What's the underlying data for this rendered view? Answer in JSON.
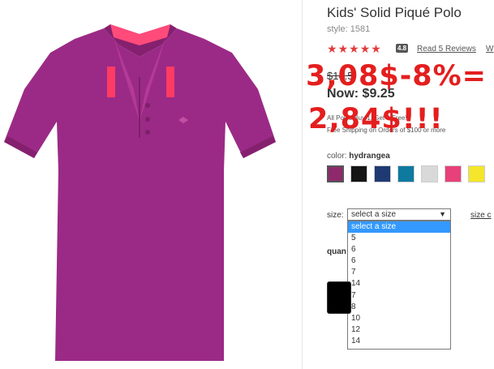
{
  "product": {
    "title": "Kids' Solid Piqué Polo",
    "style": "style: 1581",
    "rating": 4.8,
    "rating_label": "4.8",
    "stars": [
      "★",
      "★",
      "★",
      "★",
      "★"
    ],
    "reviews_link": "Read 5 Reviews",
    "write_link": "W",
    "was_price": "$14.5",
    "now_price": "Now: $9.25",
    "promo_line1": "All Polos Buy 1, Get 1 Free!",
    "promo_line2": "Free Shipping on Orders of $100 or more",
    "color_label": "color:",
    "color_value": "hydrangea",
    "swatches": [
      {
        "name": "hydrangea",
        "hex": "#8e2a6b"
      },
      {
        "name": "black",
        "hex": "#151515"
      },
      {
        "name": "navy",
        "hex": "#1f3a73"
      },
      {
        "name": "teal",
        "hex": "#0e7aa0"
      },
      {
        "name": "light gray",
        "hex": "#d9d9d9"
      },
      {
        "name": "pink",
        "hex": "#e8407a"
      },
      {
        "name": "yellow",
        "hex": "#f4e62a"
      }
    ],
    "size_label": "size:",
    "size_select_value": "select a size",
    "size_chart_link": "size c",
    "size_options": [
      "select a size",
      "5",
      "6",
      "6",
      "7",
      "14",
      "7",
      "8",
      "10",
      "12",
      "14"
    ],
    "quantity_label": "quan"
  },
  "annotation": {
    "line1": "3,08$-8%=",
    "line2": "2,84$!!!"
  },
  "colors": {
    "shirt": "#9b2a86",
    "accent_red": "#e41e1e",
    "highlight": "#3399ff"
  }
}
